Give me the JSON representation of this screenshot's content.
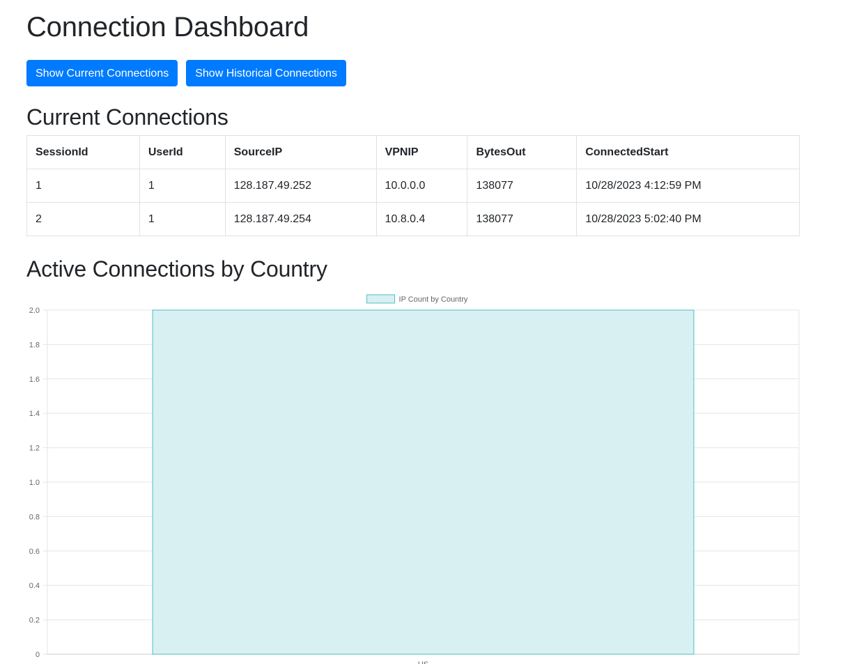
{
  "page": {
    "title": "Connection Dashboard"
  },
  "buttons": {
    "current": "Show Current Connections",
    "historical": "Show Historical Connections"
  },
  "current_section": {
    "heading": "Current Connections",
    "columns": [
      "SessionId",
      "UserId",
      "SourceIP",
      "VPNIP",
      "BytesOut",
      "ConnectedStart"
    ],
    "rows": [
      [
        "1",
        "1",
        "128.187.49.252",
        "10.0.0.0",
        "138077",
        "10/28/2023 4:12:59 PM"
      ],
      [
        "2",
        "1",
        "128.187.49.254",
        "10.8.0.4",
        "138077",
        "10/28/2023 5:02:40 PM"
      ]
    ]
  },
  "country_section": {
    "heading": "Active Connections by Country"
  },
  "colors": {
    "accent": "#007bff",
    "bar_fill": "#d9f0f2",
    "bar_stroke": "#4bc0c0",
    "grid": "#e5e5e5"
  },
  "chart_data": {
    "type": "bar",
    "categories": [
      "US"
    ],
    "series": [
      {
        "name": "IP Count by Country",
        "values": [
          2
        ]
      }
    ],
    "ylim": [
      0,
      2
    ],
    "yticks": [
      0,
      0.2,
      0.4,
      0.6,
      0.8,
      1.0,
      1.2,
      1.4,
      1.6,
      1.8,
      2.0
    ],
    "ytick_labels": [
      "0",
      "0.2",
      "0.4",
      "0.6",
      "0.8",
      "1.0",
      "1.2",
      "1.4",
      "1.6",
      "1.8",
      "2.0"
    ],
    "legend": "top-center",
    "grid": true
  }
}
